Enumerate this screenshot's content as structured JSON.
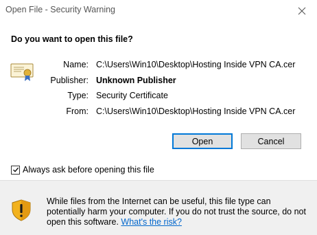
{
  "window": {
    "title": "Open File - Security Warning",
    "close_icon": "close-icon"
  },
  "prompt": {
    "question": "Do you want to open this file?"
  },
  "file_info": {
    "icon": "certificate-icon",
    "name_label": "Name:",
    "name_value": "C:\\Users\\Win10\\Desktop\\Hosting Inside VPN CA.cer",
    "publisher_label": "Publisher:",
    "publisher_value": "Unknown Publisher",
    "type_label": "Type:",
    "type_value": "Security Certificate",
    "from_label": "From:",
    "from_value": "C:\\Users\\Win10\\Desktop\\Hosting Inside VPN CA.cer"
  },
  "buttons": {
    "open_label": "Open",
    "cancel_label": "Cancel"
  },
  "options": {
    "always_ask_label": "Always ask before opening this file",
    "always_ask_checked": true
  },
  "warning": {
    "icon": "shield-warning-icon",
    "text": "While files from the Internet can be useful, this file type can potentially harm your computer. If you do not trust the source, do not open this software.",
    "link_label": "What's the risk?"
  },
  "colors": {
    "link": "#0066cc",
    "default_button_border": "#0078d7",
    "footer_background": "#f0f0f0"
  }
}
